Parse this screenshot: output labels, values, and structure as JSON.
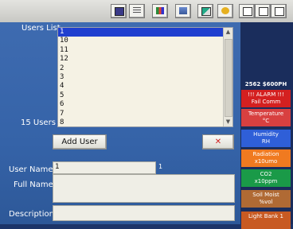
{
  "list": {
    "label": "Users List",
    "count_label": "15 Users",
    "items": [
      "1",
      "10",
      "11",
      "12",
      "2",
      "3",
      "4",
      "5",
      "6",
      "7",
      "8"
    ],
    "selected_index": 0
  },
  "buttons": {
    "add_user": "Add User",
    "delete": "✕"
  },
  "form": {
    "user_name_label": "User Name",
    "user_name_value": "1",
    "user_name_hint": "1",
    "full_name_label": "Full Name",
    "description_label": "Description"
  },
  "status": {
    "header": "2562 $600PH",
    "tiles": [
      {
        "line1": "!!! ALARM !!!",
        "line2": "Fail Comm",
        "color": "#d42020"
      },
      {
        "line1": "Temperature",
        "line2": "°C",
        "color": "#d84040"
      },
      {
        "line1": "Humidity",
        "line2": "RH",
        "color": "#2f5fd8"
      },
      {
        "line1": "Radiation",
        "line2": "x10umo",
        "color": "#f07a20"
      },
      {
        "line1": "CO2",
        "line2": "x10ppm",
        "color": "#1a9a48"
      },
      {
        "line1": "Soil Moist",
        "line2": "%vol",
        "color": "#b06a34"
      },
      {
        "line1": "Light Bank 1",
        "line2": "",
        "color": "#c85a22"
      }
    ]
  },
  "colors": {
    "panel": "#3563a8",
    "selection": "#1f3fcf",
    "list_bg": "#f5f2e4"
  }
}
